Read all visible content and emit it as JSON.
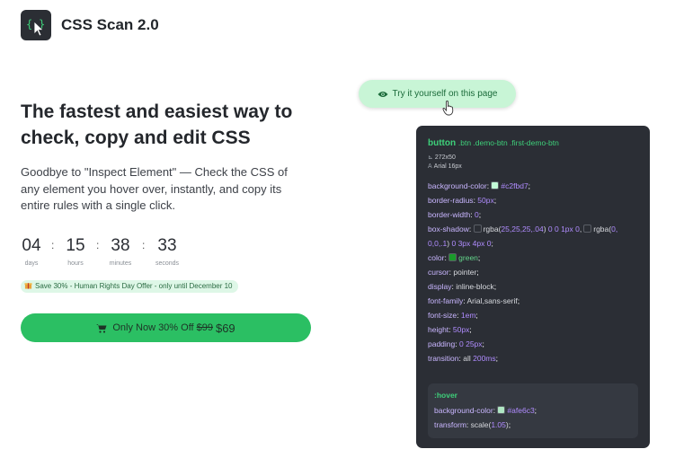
{
  "brand": {
    "name": "CSS Scan 2.0",
    "logo_text": "{ }"
  },
  "hero": {
    "headline": "The fastest and easiest way to check, copy and edit CSS",
    "subtext": "Goodbye to \"Inspect Element\" — Check the CSS of any element you hover over, instantly, and copy its entire rules with a single click."
  },
  "countdown": [
    {
      "value": "04",
      "label": "days"
    },
    {
      "value": "15",
      "label": "hours"
    },
    {
      "value": "38",
      "label": "minutes"
    },
    {
      "value": "33",
      "label": "seconds"
    }
  ],
  "offer_badge": "Save 30% - Human Rights Day Offer - only until December 10",
  "buy_button": {
    "label": "Only Now 30% Off",
    "old_price": "$99",
    "new_price": "$69"
  },
  "try_button": {
    "label": "Try it yourself on this page"
  },
  "inspector": {
    "selector": "button",
    "classes": ".btn .demo-btn .first-demo-btn",
    "size": "272x50",
    "font": "Arial 16px",
    "properties": [
      {
        "name": "background-color",
        "value": "#c2fbd7",
        "swatch": "#c2fbd7"
      },
      {
        "name": "border-radius",
        "value": "50px"
      },
      {
        "name": "border-width",
        "value": "0"
      },
      {
        "name": "box-shadow",
        "value": "rgba(25,25,25,.04) 0 0 1px 0, rgba(0,0,0,.1) 0 3px 4px 0"
      },
      {
        "name": "color",
        "value": "green",
        "swatch": "#1a9a2a"
      },
      {
        "name": "cursor",
        "value": "pointer"
      },
      {
        "name": "display",
        "value": "inline-block"
      },
      {
        "name": "font-family",
        "value": "Arial,sans-serif"
      },
      {
        "name": "font-size",
        "value": "1em"
      },
      {
        "name": "height",
        "value": "50px"
      },
      {
        "name": "padding",
        "value": "0 25px"
      },
      {
        "name": "transition",
        "value": "all 200ms"
      }
    ],
    "hover": {
      "label": ":hover",
      "properties": [
        {
          "name": "background-color",
          "value": "#afe6c3",
          "swatch": "#afe6c3"
        },
        {
          "name": "transform",
          "value": "scale(1.05)"
        }
      ]
    }
  },
  "colors": {
    "accent_green": "#2bbf63",
    "try_bg": "#c8f5d6",
    "panel_bg": "#2b2e35"
  },
  "icons": [
    "cursor-logo-icon",
    "gift-icon",
    "cart-icon",
    "eye-icon",
    "hand-pointer-icon",
    "ruler-icon",
    "font-icon"
  ]
}
